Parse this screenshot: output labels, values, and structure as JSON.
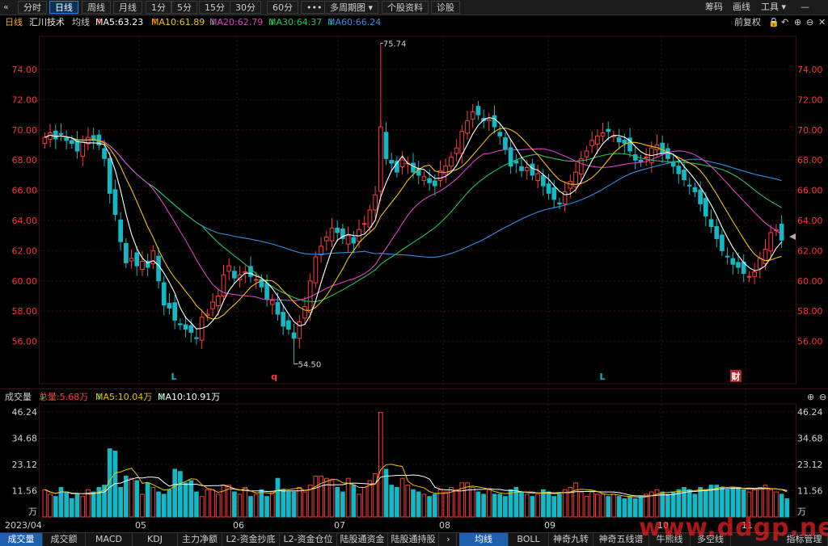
{
  "toolbar": {
    "back_icon": "«",
    "period_tabs": [
      "分时",
      "日线",
      "周线",
      "月线",
      "1分",
      "5分",
      "15分",
      "30分",
      "60分"
    ],
    "active_tab": "日线",
    "more_label": "•••",
    "multi_period_label": "多周期图",
    "stock_info_label": "个股资料",
    "diagnose_label": "诊股",
    "right_items": [
      "筹码",
      "画线",
      "工具"
    ]
  },
  "main_legend": {
    "period": "日线",
    "stock_name": "汇川技术",
    "indicator": "均线",
    "ma5": "MA5:63.23",
    "ma10": "MA10:61.89",
    "ma20": "MA20:62.79",
    "ma30": "MA30:64.37",
    "ma60": "MA60:66.24",
    "adjust_label": "前复权"
  },
  "colors": {
    "up": "#ff3b3b",
    "down": "#14b8c4",
    "ma5": "#ffffff",
    "ma10": "#f2c200",
    "ma20": "#e040c8",
    "ma30": "#22c35a",
    "ma60": "#2e8fe6",
    "axis_text": "#ff3333",
    "grid": "#3a0f0f"
  },
  "chart_data": [
    {
      "type": "candlestick",
      "title": "汇川技术 日线",
      "ylim": [
        54.5,
        75.9
      ],
      "y_ticks": [
        "74.00",
        "72.00",
        "70.00",
        "68.00",
        "66.00",
        "64.00",
        "62.00",
        "60.00",
        "58.00",
        "56.00"
      ],
      "annotations": [
        {
          "label": "75.74",
          "kind": "high"
        },
        {
          "label": "54.50",
          "kind": "low"
        }
      ],
      "markers": [
        "L",
        "q",
        "L",
        "财"
      ],
      "closes": [
        69.5,
        69.8,
        69.4,
        69.7,
        69.3,
        69.1,
        68.6,
        69.2,
        69.5,
        69.3,
        69.0,
        68.1,
        65.8,
        64.4,
        62.6,
        61.2,
        61.5,
        61.0,
        61.3,
        60.9,
        62.0,
        60.0,
        58.4,
        58.2,
        57.4,
        57.1,
        56.8,
        56.6,
        56.2,
        57.6,
        57.8,
        58.6,
        59.0,
        60.4,
        61.0,
        60.2,
        60.4,
        60.6,
        60.3,
        60.1,
        59.6,
        58.8,
        58.7,
        57.8,
        57.0,
        56.8,
        56.2,
        57.3,
        58.3,
        60.0,
        61.6,
        62.3,
        62.9,
        63.5,
        63.2,
        62.8,
        63.0,
        62.5,
        63.4,
        63.8,
        64.7,
        65.7,
        70.2,
        68.1,
        67.8,
        67.2,
        68.0,
        67.8,
        67.2,
        67.0,
        66.9,
        66.5,
        66.3,
        67.3,
        67.6,
        68.2,
        68.8,
        69.9,
        70.6,
        71.2,
        71.0,
        70.6,
        70.7,
        70.2,
        69.6,
        68.7,
        67.6,
        67.8,
        67.3,
        67.5,
        67.0,
        67.1,
        66.3,
        65.8,
        65.4,
        65.1,
        65.9,
        66.6,
        67.2,
        68.1,
        68.6,
        69.3,
        69.6,
        69.8,
        69.9,
        69.6,
        69.2,
        69.1,
        68.6,
        68.0,
        67.9,
        68.2,
        68.8,
        69.0,
        68.4,
        68.1,
        67.6,
        67.1,
        66.7,
        66.3,
        65.9,
        65.1,
        64.3,
        63.6,
        62.8,
        62.0,
        61.6,
        61.1,
        60.9,
        60.5,
        60.3,
        60.6,
        61.5,
        62.1,
        63.2,
        63.4,
        62.7
      ]
    },
    {
      "type": "bar",
      "title": "成交量",
      "unit": "万",
      "ylim": [
        0,
        46.24
      ],
      "y_ticks": [
        "46.24",
        "34.68",
        "23.12",
        "11.56",
        "万"
      ],
      "x_ticks": [
        "2023/04",
        "05",
        "06",
        "07",
        "08",
        "09",
        "10",
        "11"
      ],
      "total_volume": "总量:5.68万",
      "ma5": "MA5:10.04万",
      "ma10": "MA10:10.91万",
      "values": [
        12,
        10,
        9,
        13,
        11,
        8,
        10,
        9,
        12,
        11,
        13,
        14,
        30,
        29,
        13,
        18,
        17,
        16,
        10,
        15,
        13,
        11,
        10,
        12,
        21,
        20,
        15,
        16,
        11,
        9,
        12,
        12,
        10,
        14,
        14,
        11,
        10,
        13,
        9,
        10,
        12,
        9,
        11,
        17,
        12,
        11,
        11,
        13,
        11,
        14,
        18,
        18,
        17,
        16,
        13,
        11,
        17,
        14,
        10,
        13,
        16,
        19,
        46,
        21,
        14,
        13,
        17,
        14,
        12,
        11,
        10,
        9,
        10,
        12,
        11,
        13,
        12,
        15,
        15,
        13,
        11,
        10,
        12,
        10,
        10,
        9,
        12,
        13,
        11,
        10,
        9,
        10,
        12,
        11,
        9,
        10,
        12,
        13,
        15,
        11,
        9,
        11,
        10,
        10,
        9,
        10,
        9,
        8,
        9,
        8,
        9,
        10,
        11,
        12,
        11,
        10,
        11,
        12,
        13,
        12,
        10,
        13,
        12,
        14,
        14,
        13,
        12,
        13,
        13,
        12,
        11,
        12,
        13,
        14,
        12,
        11,
        10,
        8
      ]
    }
  ],
  "volume_legend": {
    "title": "成交量",
    "total": "总量:5.68万",
    "ma5": "MA5:10.04万",
    "ma10": "MA10:10.91万"
  },
  "bottom_tabs": [
    "成交量",
    "成交额",
    "MACD",
    "KDJ",
    "主力净额",
    "L2-资金抄底",
    "L2-资金仓位",
    "陆股通资金",
    "陆股通持股",
    "均线",
    "BOLL",
    "神奇九转",
    "神奇五线谱",
    "牛熊线",
    "多空线",
    "指标管理"
  ],
  "bottom_active": [
    "成交量",
    "均线"
  ],
  "watermark": "www.ddgp.net"
}
